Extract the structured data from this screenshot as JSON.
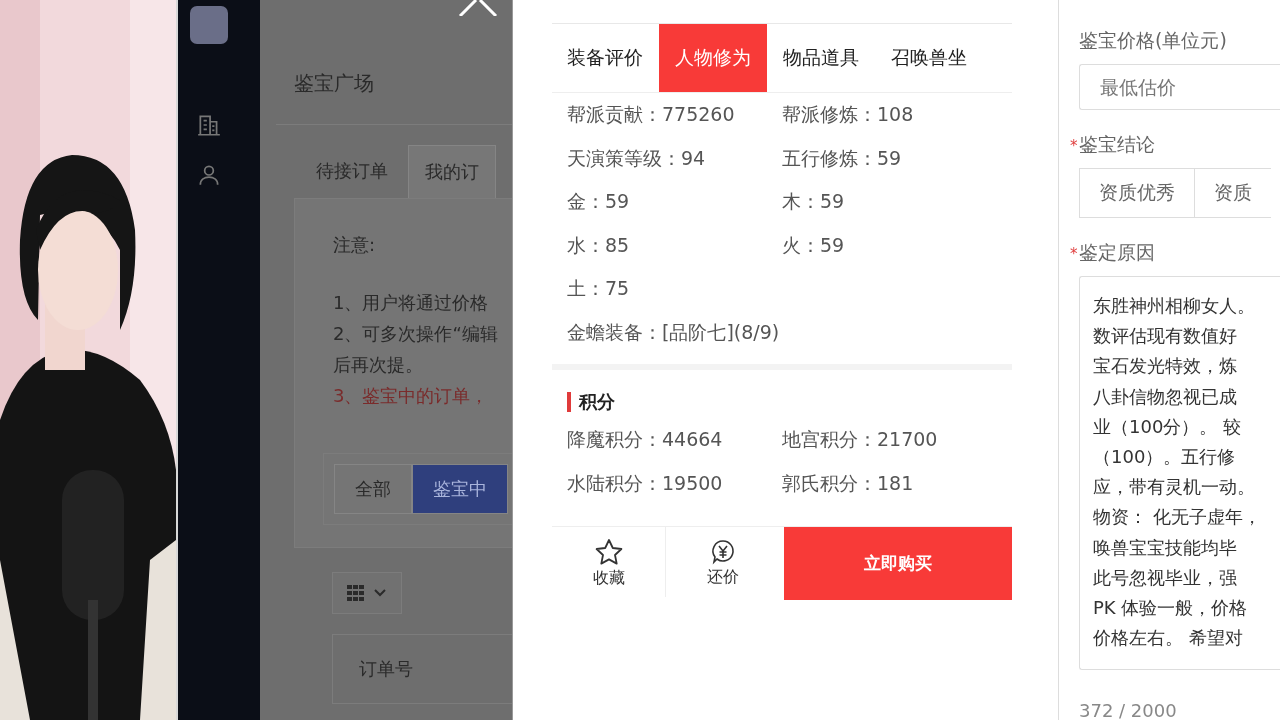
{
  "background_app": {
    "page_title": "鉴宝广场",
    "tabs": [
      {
        "label": "待接订单",
        "selected": false
      },
      {
        "label": "我的订",
        "selected": true
      }
    ],
    "notice_title": "注意:",
    "notices": [
      {
        "text": "1、用户将通过价格",
        "warning": false
      },
      {
        "text": "2、可多次操作“编辑",
        "warning": false
      },
      {
        "text": "后再次提。",
        "warning": false
      },
      {
        "text": "3、鉴宝中的订单，",
        "warning": true
      }
    ],
    "filters": [
      {
        "label": "全部",
        "selected": false
      },
      {
        "label": "鉴宝中",
        "selected": true
      }
    ],
    "table_header": "订单号"
  },
  "detail": {
    "tabs": [
      {
        "label": "装备评价",
        "selected": false
      },
      {
        "label": "人物修为",
        "selected": true
      },
      {
        "label": "物品道具",
        "selected": false
      },
      {
        "label": "召唤兽坐",
        "selected": false
      }
    ],
    "stats": [
      "帮派贡献：775260",
      "帮派修炼：108",
      "天演策等级：94",
      "五行修炼：59",
      "金：59",
      "木：59",
      "水：85",
      "火：59",
      "土：75"
    ],
    "equipment": "金蟾装备：[品阶七](8/9)",
    "section_title": "积分",
    "scores": [
      "降魔积分：44664",
      "地宫积分：21700",
      "水陆积分：19500",
      "郭氏积分：181"
    ],
    "favorite": "收藏",
    "bargain": "还价",
    "buy": "立即购买"
  },
  "appraisal": {
    "price_label": "鉴宝价格(单位元)",
    "price_placeholder": "最低估价",
    "conclusion_label": "鉴宝结论",
    "conclusion_mark": "*",
    "conclusions": [
      {
        "label": "资质优秀",
        "selected": false
      },
      {
        "label": "资质",
        "selected": false
      }
    ],
    "reason_label": "鉴定原因",
    "reason_mark": "*",
    "reason_lines": [
      "东胜神州相柳女人。",
      "数评估现有数值好",
      "宝石发光特效，炼",
      "八卦信物忽视已成",
      "业（100分）。 较",
      "（100）。五行修",
      "应，带有灵机一动。",
      "物资： 化无子虚年，",
      "唤兽宝宝技能均毕",
      "此号忽视毕业，强",
      "PK 体验一般，价格",
      "价格左右。 希望对"
    ],
    "counter": "372 / 2000"
  }
}
